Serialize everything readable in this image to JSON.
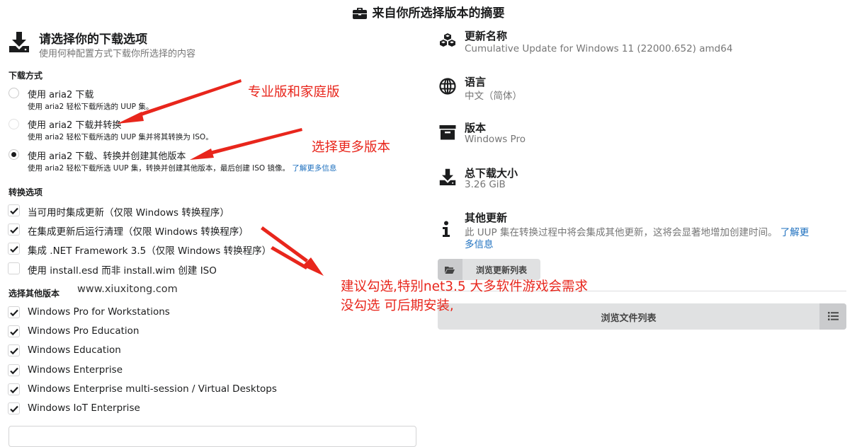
{
  "page_title": "来自你所选择版本的摘要",
  "left": {
    "heading": "请选择你的下载选项",
    "subheading": "使用何种配置方式下载你所选择的内容",
    "download_group": "下载方式",
    "download_options": [
      {
        "label": "使用 aria2 下载",
        "desc": "使用 aria2 轻松下载所选的 UUP 集。",
        "selected": false
      },
      {
        "label": "使用 aria2 下载并转换",
        "desc": "使用 aria2 轻松下载所选的 UUP 集并将其转换为 ISO。",
        "selected": false
      },
      {
        "label": "使用 aria2 下载、转换并创建其他版本",
        "desc": "使用 aria2 轻松下载所选 UUP 集，转换并创建其他版本，最后创建 ISO 镜像。",
        "link": "了解更多信息",
        "selected": true
      }
    ],
    "convert_group": "转换选项",
    "convert_options": [
      {
        "label": "当可用时集成更新（仅限 Windows 转换程序）",
        "checked": true
      },
      {
        "label": "在集成更新后运行清理（仅限 Windows 转换程序）",
        "checked": true
      },
      {
        "label": "集成 .NET Framework 3.5（仅限 Windows 转换程序）",
        "checked": true
      },
      {
        "label": "使用 install.esd 而非 install.wim 创建 ISO",
        "checked": false
      }
    ],
    "editions_group": "选择其他版本",
    "watermark": "www.xiuxitong.com",
    "editions": [
      {
        "label": "Windows Pro for Workstations",
        "checked": true
      },
      {
        "label": "Windows Pro Education",
        "checked": true
      },
      {
        "label": "Windows Education",
        "checked": true
      },
      {
        "label": "Windows Enterprise",
        "checked": true
      },
      {
        "label": "Windows Enterprise multi-session / Virtual Desktops",
        "checked": true
      },
      {
        "label": "Windows IoT Enterprise",
        "checked": true
      }
    ]
  },
  "right": {
    "update_name": {
      "label": "更新名称",
      "value": "Cumulative Update for Windows 11 (22000.652) amd64"
    },
    "language": {
      "label": "语言",
      "value": "中文（简体）"
    },
    "edition": {
      "label": "版本",
      "value": "Windows Pro"
    },
    "total_size": {
      "label": "总下载大小",
      "value": "3.26 GiB"
    },
    "other_updates": {
      "label": "其他更新",
      "text_line1": "此 UUP 集在转换过程中将会集成其他更新，这将会显著地增加创建时间。",
      "link_part1": "了解更",
      "link_part2": "多信息"
    },
    "browse_updates_button": "浏览更新列表",
    "browse_files_button": "浏览文件列表"
  },
  "annotations": {
    "note1": "专业版和家庭版",
    "note2": "选择更多版本",
    "note3_line1": "建议勾选,特别net3.5 大多软件游戏会需求",
    "note3_line2": "没勾选 可后期安装,"
  },
  "colors": {
    "annotation": "#e8261c",
    "link": "#1e70bf",
    "button_bg": "#e0e1e2"
  }
}
